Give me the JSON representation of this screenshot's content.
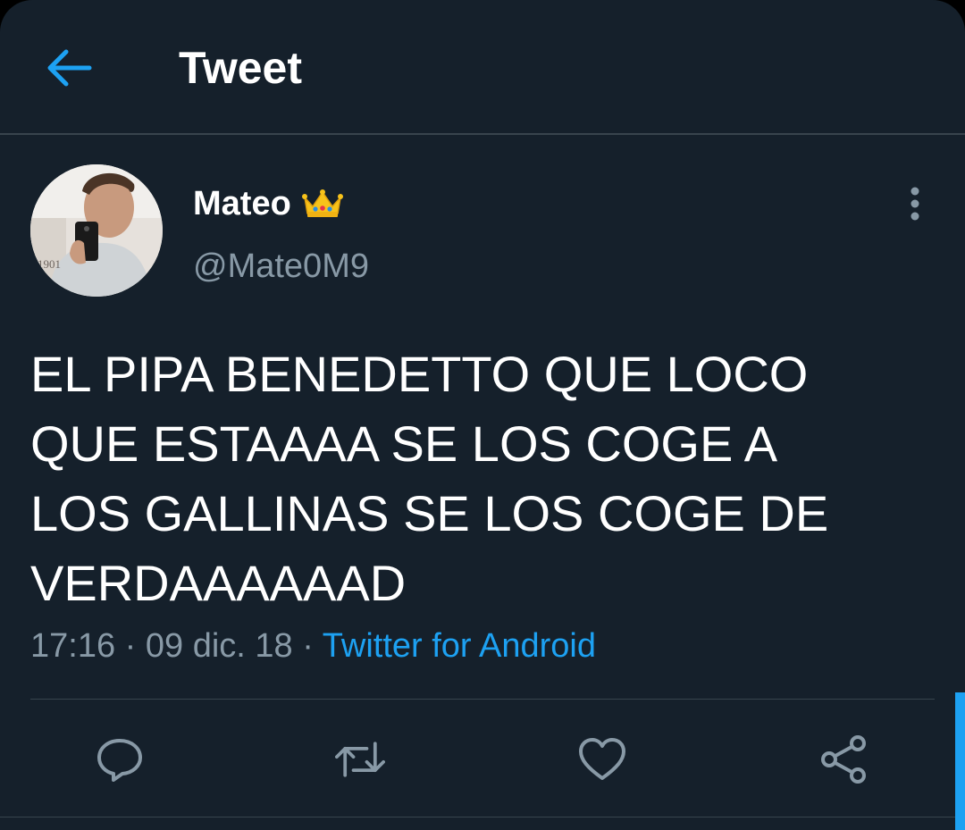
{
  "header": {
    "title": "Tweet",
    "back_icon": "arrow-left-icon"
  },
  "author": {
    "display_name": "Mateo",
    "badge_icon": "crown-emoji-icon",
    "handle": "@Mate0M9"
  },
  "tweet": {
    "lines": [
      "EL PIPA BENEDETTO QUE LOCO",
      "QUE ESTAAAA SE LOS COGE A",
      "LOS GALLINAS SE LOS COGE DE",
      "VERDAAAAAAD"
    ],
    "time": "17:16",
    "date": "09 dic. 18",
    "separator": "·",
    "source": "Twitter for Android"
  },
  "actions": {
    "reply_icon": "reply-icon",
    "retweet_icon": "retweet-icon",
    "like_icon": "heart-icon",
    "share_icon": "share-icon"
  },
  "colors": {
    "background": "#15202b",
    "accent": "#1da1f2",
    "secondary_text": "#8899a6",
    "divider": "#38444d"
  }
}
